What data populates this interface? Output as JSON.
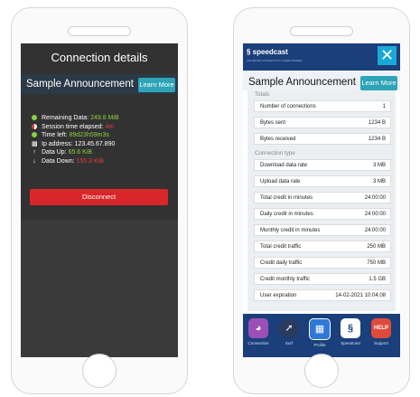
{
  "left_screen": {
    "title": "Connection details",
    "announcement": {
      "text": "Sample Announcement",
      "button": "Learn More"
    },
    "status": [
      {
        "label": "Remaining Data:",
        "value": "249.8 MiB",
        "icon": "green-dot-icon",
        "value_color": "green"
      },
      {
        "label": "Session time elapsed:",
        "value": "4m",
        "icon": "half-circle-icon",
        "value_color": "red"
      },
      {
        "label": "Time left:",
        "value": "89d23h59m3s",
        "icon": "green-dot-icon",
        "value_color": "green"
      },
      {
        "label": "Ip address:",
        "value": "123.45.67.890",
        "icon": "network-icon",
        "value_color": "white"
      },
      {
        "label": "Data Up:",
        "value": "65.6 KiB",
        "icon": "up-arrow-icon",
        "value_color": "green"
      },
      {
        "label": "Data Down:",
        "value": "155.3 KiB",
        "icon": "down-arrow-icon",
        "value_color": "red"
      }
    ],
    "disconnect_label": "Disconnect"
  },
  "right_screen": {
    "brand": "speedcast",
    "brand_tagline": "UNLIMITED CONNECTIVITY EVERYWHERE",
    "announcement": {
      "text": "Sample Announcement",
      "button": "Learn More"
    },
    "totals_label": "Totals",
    "totals": [
      {
        "key": "Number of connections",
        "value": "1"
      },
      {
        "key": "Bytes sent",
        "value": "1234 B"
      },
      {
        "key": "Bytes received",
        "value": "1234 B"
      }
    ],
    "connection_type_label": "Connection type",
    "connection": [
      {
        "key": "Download data rate",
        "value": "3 MB"
      },
      {
        "key": "Upload data rate",
        "value": "3 MB"
      },
      {
        "key": "Total credit in minutes",
        "value": "24:00:00"
      },
      {
        "key": "Daily credit in minutes",
        "value": "24:00:00"
      },
      {
        "key": "Monthly credit in minutes",
        "value": "24:00:00"
      },
      {
        "key": "Total credit traffic",
        "value": "250 MB"
      },
      {
        "key": "Credit daily traffic",
        "value": "750 MB"
      },
      {
        "key": "Credit monthly traffic",
        "value": "1.5 GB"
      },
      {
        "key": "User expiration",
        "value": "14-02-2021 10:04:08"
      }
    ],
    "dock": [
      {
        "label": "Connection",
        "icon": "gauge-icon",
        "color": "#9c4fb8"
      },
      {
        "label": "Surf",
        "icon": "compass-icon",
        "color": "#2a3a5c"
      },
      {
        "label": "Profile",
        "icon": "profile-card-icon",
        "color": "#2f78d6"
      },
      {
        "label": "Speedcast",
        "icon": "speedcast-logo-icon",
        "color": "#ffffff"
      },
      {
        "label": "Support",
        "icon": "help-lifebuoy-icon",
        "color": "#e04a3a"
      }
    ]
  }
}
